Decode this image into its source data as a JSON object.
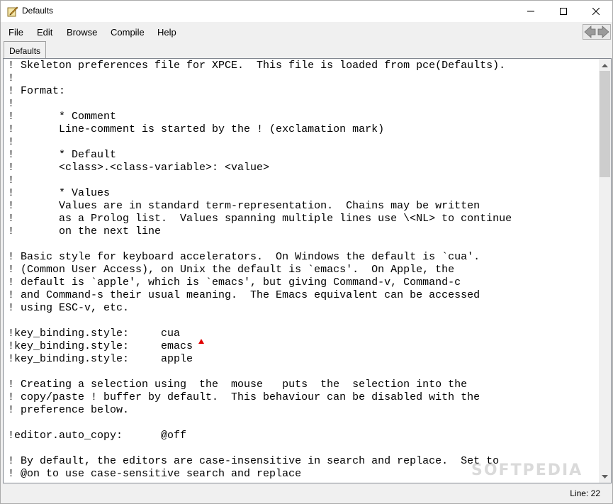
{
  "window": {
    "title": "Defaults",
    "controls": {
      "minimize_icon": "minimize-icon",
      "maximize_icon": "maximize-icon",
      "close_icon": "close-icon"
    }
  },
  "menu": {
    "file": "File",
    "edit": "Edit",
    "browse": "Browse",
    "compile": "Compile",
    "help": "Help"
  },
  "tab": {
    "label": "Defaults"
  },
  "editor": {
    "lines": [
      "! Skeleton preferences file for XPCE.  This file is loaded from pce(Defaults).",
      "!",
      "! Format:",
      "!",
      "!       * Comment",
      "!       Line-comment is started by the ! (exclamation mark)",
      "!",
      "!       * Default",
      "!       <class>.<class-variable>: <value>",
      "!",
      "!       * Values",
      "!       Values are in standard term-representation.  Chains may be written",
      "!       as a Prolog list.  Values spanning multiple lines use \\<NL> to continue",
      "!       on the next line",
      "",
      "! Basic style for keyboard accelerators.  On Windows the default is `cua'.",
      "! (Common User Access), on Unix the default is `emacs'.  On Apple, the",
      "! default is `apple', which is `emacs', but giving Command-v, Command-c",
      "! and Command-s their usual meaning.  The Emacs equivalent can be accessed",
      "! using ESC-v, etc.",
      "",
      "!key_binding.style:     cua",
      "!key_binding.style:     emacs",
      "!key_binding.style:     apple",
      "",
      "! Creating a selection using  the  mouse   puts  the  selection into the",
      "! copy/paste ! buffer by default.  This behaviour can be disabled with the",
      "! preference below.",
      "",
      "!editor.auto_copy:      @off",
      "",
      "! By default, the editors are case-insensitive in search and replace.  Set to",
      "! @on to use case-sensitive search and replace",
      ""
    ]
  },
  "status": {
    "line": "Line: 22"
  },
  "watermark": "SOFTPEDIA",
  "colors": {
    "caret_marker": "#e00000",
    "background": "#f0f0f0",
    "editor_bg": "#ffffff"
  }
}
